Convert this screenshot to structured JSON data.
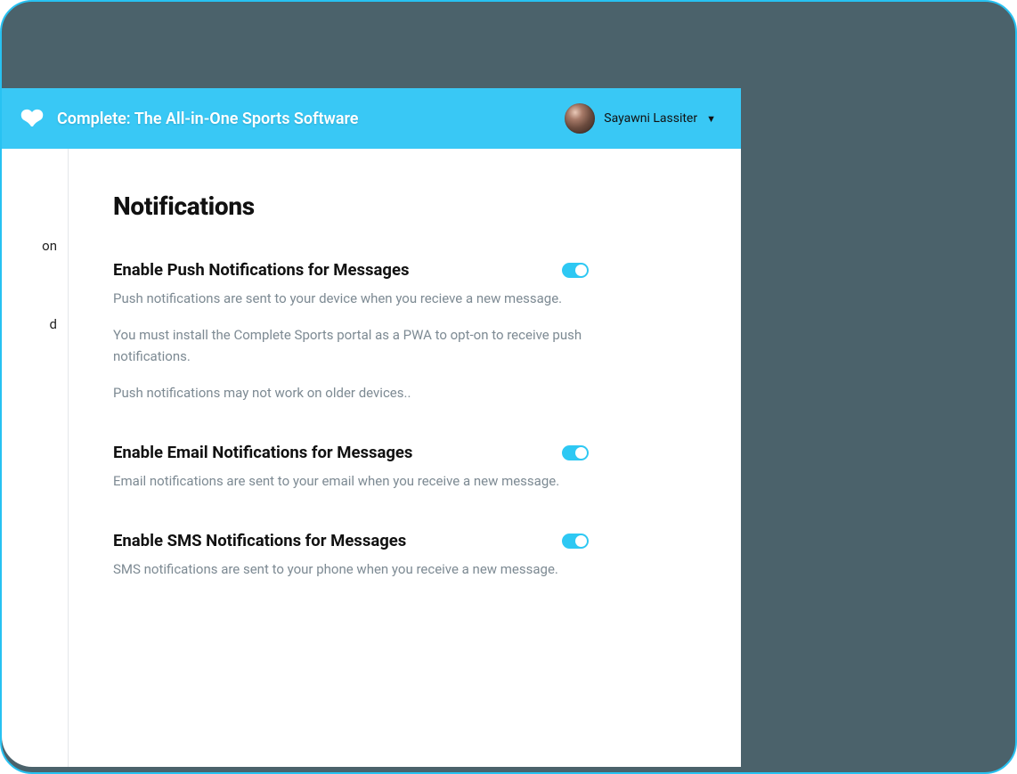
{
  "header": {
    "app_title": "Complete: The All-in-One Sports Software",
    "user_name": "Sayawni Lassiter"
  },
  "sidebar": {
    "items": [
      {
        "label": "on"
      },
      {
        "label": "d"
      }
    ]
  },
  "page": {
    "title": "Notifications"
  },
  "settings": [
    {
      "title": "Enable Push Notifications for Messages",
      "desc": "Push notifications are sent to your device when you recieve a new message.",
      "notes": [
        "You must install the Complete Sports portal as a PWA to opt-on to receive push notifications.",
        "Push notifications may not work on older devices.."
      ],
      "enabled": true
    },
    {
      "title": "Enable Email Notifications for Messages",
      "desc": "Email notifications are sent to your email when you receive a new message.",
      "notes": [],
      "enabled": true
    },
    {
      "title": "Enable SMS Notifications for Messages",
      "desc": "SMS notifications are sent to your phone when you receive a new message.",
      "notes": [],
      "enabled": true
    }
  ],
  "colors": {
    "accent": "#39c8f5",
    "toggle": "#2ec8f3",
    "frame": "#4b626b"
  }
}
